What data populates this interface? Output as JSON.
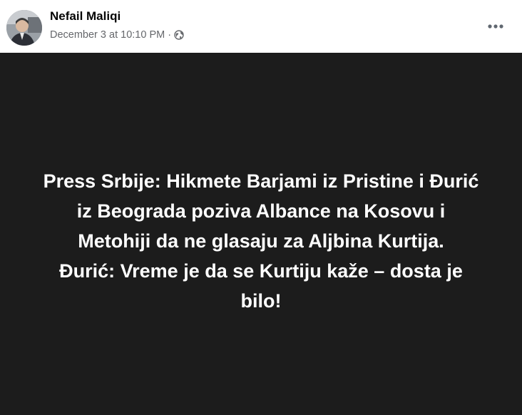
{
  "header": {
    "author_name": "Nefail Maliqi",
    "timestamp": "December 3 at 10:10 PM",
    "separator": "·",
    "privacy_icon": "globe-icon",
    "more_icon": "more-options-icon"
  },
  "post": {
    "lines": [
      "Press Srbije: Hikmete Barjami iz Pristine i Đurić",
      "iz Beograda poziva Albance na Kosovu i",
      "Metohiji da ne glasaju za Aljbina Kurtija.",
      "Đurić: Vreme je da se Kurtiju kaže – dosta je",
      "bilo!"
    ],
    "background_color": "#1c1c1c",
    "text_color": "#ffffff"
  }
}
